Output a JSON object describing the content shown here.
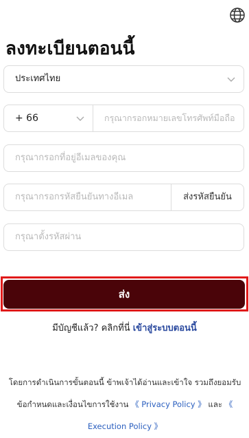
{
  "header": {
    "language_icon": "globe-icon",
    "title": "ลงทะเบียนตอนนี้"
  },
  "form": {
    "country_value": "ประเทศไทย",
    "phone_code": "+ 66",
    "phone_placeholder": "กรุณากรอกหมายเลขโทรศัพท์มือถือ",
    "email_placeholder": "กรุณากรอกที่อยู่อีเมลของคุณ",
    "code_placeholder": "กรุณากรอกรหัสยืนยันทางอีเมล",
    "send_code_label": "ส่งรหัสยืนยัน",
    "password_placeholder": "กรุณาตั้งรหัสผ่าน",
    "submit_label": "ส่ง"
  },
  "login": {
    "prompt": "มีบัญชีแล้ว? คลิกที่นี่",
    "link": "เข้าสู่ระบบตอนนี้"
  },
  "terms": {
    "text_1": "โดยการดำเนินการขั้นตอนนี้ ข้าพเจ้าได้อ่านและเข้าใจ รวมถึงยอมรับข้อกำหนดและเงื่อนไขการใช้งาน",
    "privacy_link": "《 Privacy Policy 》",
    "and": "และ",
    "execution_link": "《 Execution Policy 》"
  },
  "colors": {
    "submit_bg": "#4a0409",
    "highlight_border": "#e01919",
    "link": "#2b5fbf"
  }
}
